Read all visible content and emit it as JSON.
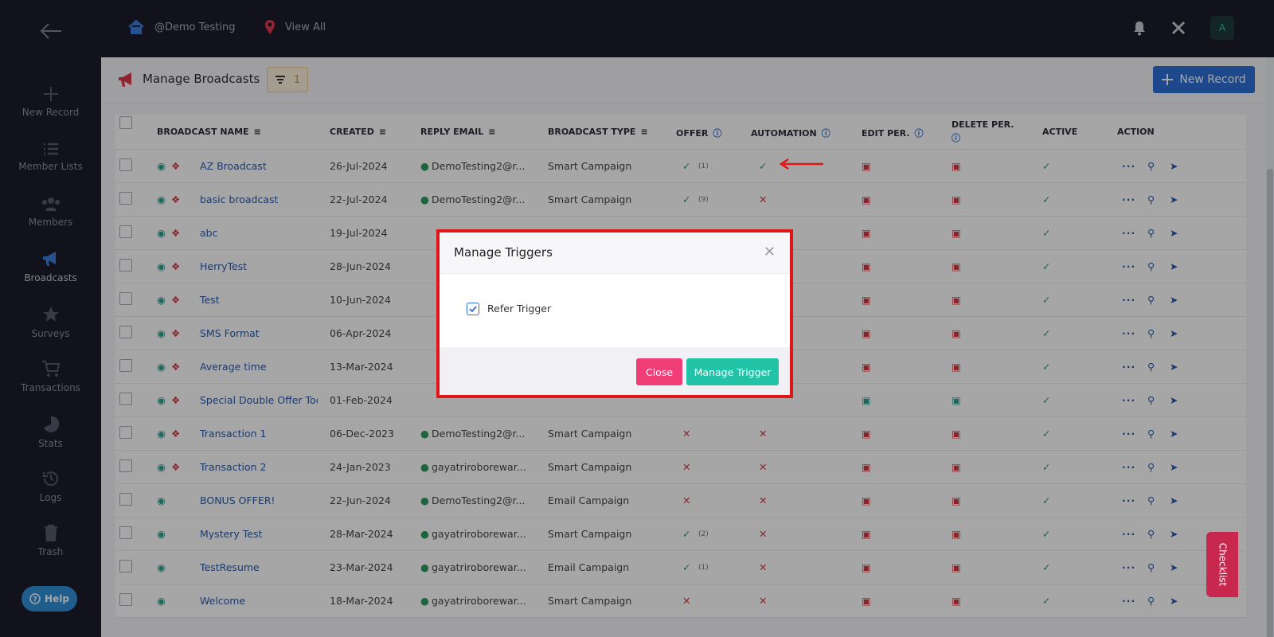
{
  "topbar": {
    "breadcrumb_home": "@Demo Testing",
    "breadcrumb_location": "View All",
    "avatar_initial": "A"
  },
  "sidebar": {
    "items": [
      {
        "label": "New Record",
        "icon": "plus-icon"
      },
      {
        "label": "Member Lists",
        "icon": "list-icon"
      },
      {
        "label": "Members",
        "icon": "users-icon"
      },
      {
        "label": "Broadcasts",
        "icon": "megaphone-icon",
        "active": true
      },
      {
        "label": "Surveys",
        "icon": "star-icon"
      },
      {
        "label": "Transactions",
        "icon": "cart-icon"
      },
      {
        "label": "Stats",
        "icon": "pie-icon"
      },
      {
        "label": "Logs",
        "icon": "history-icon"
      },
      {
        "label": "Trash",
        "icon": "trash-icon"
      }
    ],
    "help_label": "Help"
  },
  "header": {
    "title": "Manage Broadcasts",
    "filter_count": "1",
    "new_record_label": "New Record"
  },
  "table": {
    "columns": [
      "BROADCAST NAME",
      "CREATED",
      "REPLY EMAIL",
      "BROADCAST TYPE",
      "OFFER",
      "AUTOMATION",
      "EDIT PER.",
      "DELETE PER.",
      "ACTIVE",
      "ACTION"
    ],
    "rows": [
      {
        "name": "AZ Broadcast",
        "created": "26-Jul-2024",
        "email": "DemoTesting2@r...",
        "type": "Smart Campaign",
        "offer": "(1)"
      },
      {
        "name": "basic broadcast",
        "created": "22-Jul-2024",
        "email": "DemoTesting2@r...",
        "type": "Smart Campaign",
        "offer": "(9)"
      },
      {
        "name": "abc",
        "created": "19-Jul-2024",
        "email": "",
        "type": "",
        "offer": ""
      },
      {
        "name": "HerryTest",
        "created": "28-Jun-2024",
        "email": "",
        "type": "",
        "offer": ""
      },
      {
        "name": "Test",
        "created": "10-Jun-2024",
        "email": "",
        "type": "",
        "offer": ""
      },
      {
        "name": "SMS Format",
        "created": "06-Apr-2024",
        "email": "",
        "type": "",
        "offer": ""
      },
      {
        "name": "Average time",
        "created": "13-Mar-2024",
        "email": "",
        "type": "",
        "offer": ""
      },
      {
        "name": "Special Double Offer Todo",
        "created": "01-Feb-2024",
        "email": "",
        "type": "",
        "offer": ""
      },
      {
        "name": "Transaction 1",
        "created": "06-Dec-2023",
        "email": "DemoTesting2@r...",
        "type": "Smart Campaign",
        "offer": ""
      },
      {
        "name": "Transaction 2",
        "created": "24-Jan-2023",
        "email": "gayatriroborewar...",
        "type": "Smart Campaign",
        "offer": ""
      },
      {
        "name": "BONUS OFFER!",
        "created": "22-Jun-2024",
        "email": "DemoTesting2@r...",
        "type": "Email Campaign",
        "offer": ""
      },
      {
        "name": "Mystery Test",
        "created": "28-Mar-2024",
        "email": "gayatriroborewar...",
        "type": "Smart Campaign",
        "offer": "(2)"
      },
      {
        "name": "TestResume",
        "created": "23-Mar-2024",
        "email": "gayatriroborewar...",
        "type": "Email Campaign",
        "offer": "(1)"
      },
      {
        "name": "Welcome",
        "created": "18-Mar-2024",
        "email": "gayatriroborewar...",
        "type": "Smart Campaign",
        "offer": ""
      }
    ]
  },
  "modal": {
    "title": "Manage Triggers",
    "option_label": "Refer Trigger",
    "close_label": "Close",
    "manage_label": "Manage Trigger"
  },
  "checklist_label": "Checklist",
  "colors": {
    "primary": "#2d6fd6",
    "teal": "#21c2a6",
    "pink": "#ef3e77",
    "highlight": "#e01616"
  }
}
